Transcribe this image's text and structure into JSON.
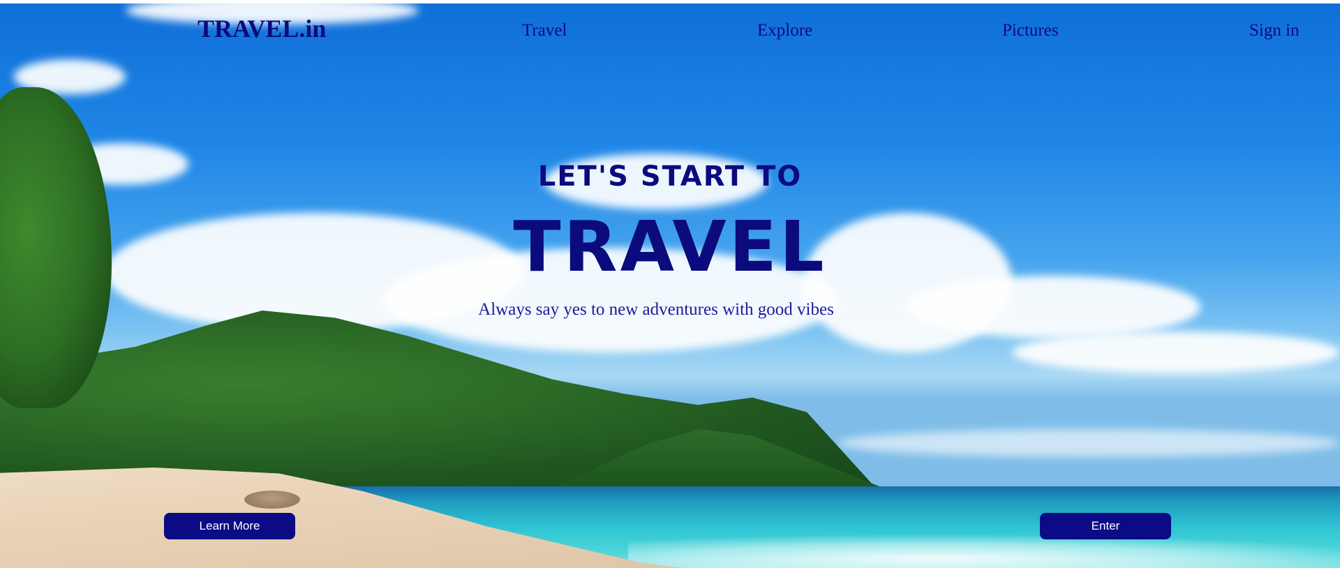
{
  "nav": {
    "logo": "TRAVEL.in",
    "links": [
      "Travel",
      "Explore",
      "Pictures",
      "Sign in"
    ]
  },
  "hero": {
    "pretitle": "LET'S START TO",
    "title": "TRAVEL",
    "subtitle": "Always say yes to new adventures with good vibes"
  },
  "buttons": {
    "learn_more": "Learn More",
    "enter": "Enter"
  },
  "colors": {
    "accent": "#0b0b7e",
    "button_bg": "#0b0b86",
    "button_text": "#ffffff"
  }
}
